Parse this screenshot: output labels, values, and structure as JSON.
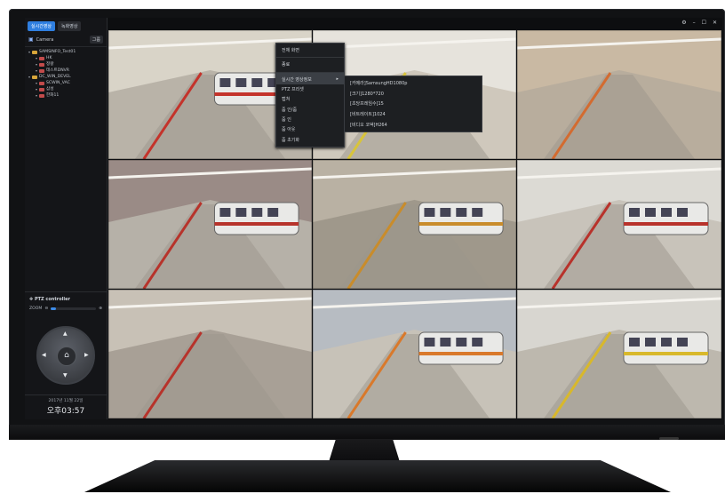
{
  "app": {
    "tabs": [
      "실시간영상",
      "녹화영상"
    ],
    "camera_header": "Camera",
    "group_button": "그룹",
    "tree": [
      {
        "label": "SAMSINFO_Test01",
        "level": 0,
        "color": "yellow"
      },
      {
        "label": "HK",
        "level": 1,
        "color": "red"
      },
      {
        "label": "정왕",
        "level": 1,
        "color": "red"
      },
      {
        "label": "테스트DNVR",
        "level": 1,
        "color": "red"
      },
      {
        "label": "DC_WIN_DEVEL",
        "level": 0,
        "color": "yellow"
      },
      {
        "label": "SCWIN_VAC",
        "level": 1,
        "color": "red"
      },
      {
        "label": "삼성",
        "level": 1,
        "color": "red"
      },
      {
        "label": "한화11",
        "level": 1,
        "color": "red"
      }
    ],
    "ptz": {
      "title": "PTZ controller",
      "zoom_label": "ZOOM",
      "zoom_level": 0.12,
      "home_icon": "home-icon"
    },
    "clock": {
      "date": "2017년 11월 22일",
      "time": "오후03:57"
    },
    "window_controls": [
      "gear-icon",
      "minimize-icon",
      "maximize-icon",
      "close-icon"
    ],
    "context_menu": {
      "items": [
        "전체 화면",
        "종료",
        "실시간 영상정보",
        "PTZ 프리셋",
        "캡쳐",
        "줌 인/줌",
        "줌 인",
        "줌 아웃",
        "줌 초기화"
      ],
      "highlighted": "실시간 영상정보"
    },
    "submenu": {
      "items": [
        "[카메라]SamsungHD1080p",
        "[크기]1280*720",
        "[초당프레임수]15",
        "[비트레이트]1024",
        "[비디오 코덱]H264"
      ]
    },
    "video_cells": 9
  }
}
